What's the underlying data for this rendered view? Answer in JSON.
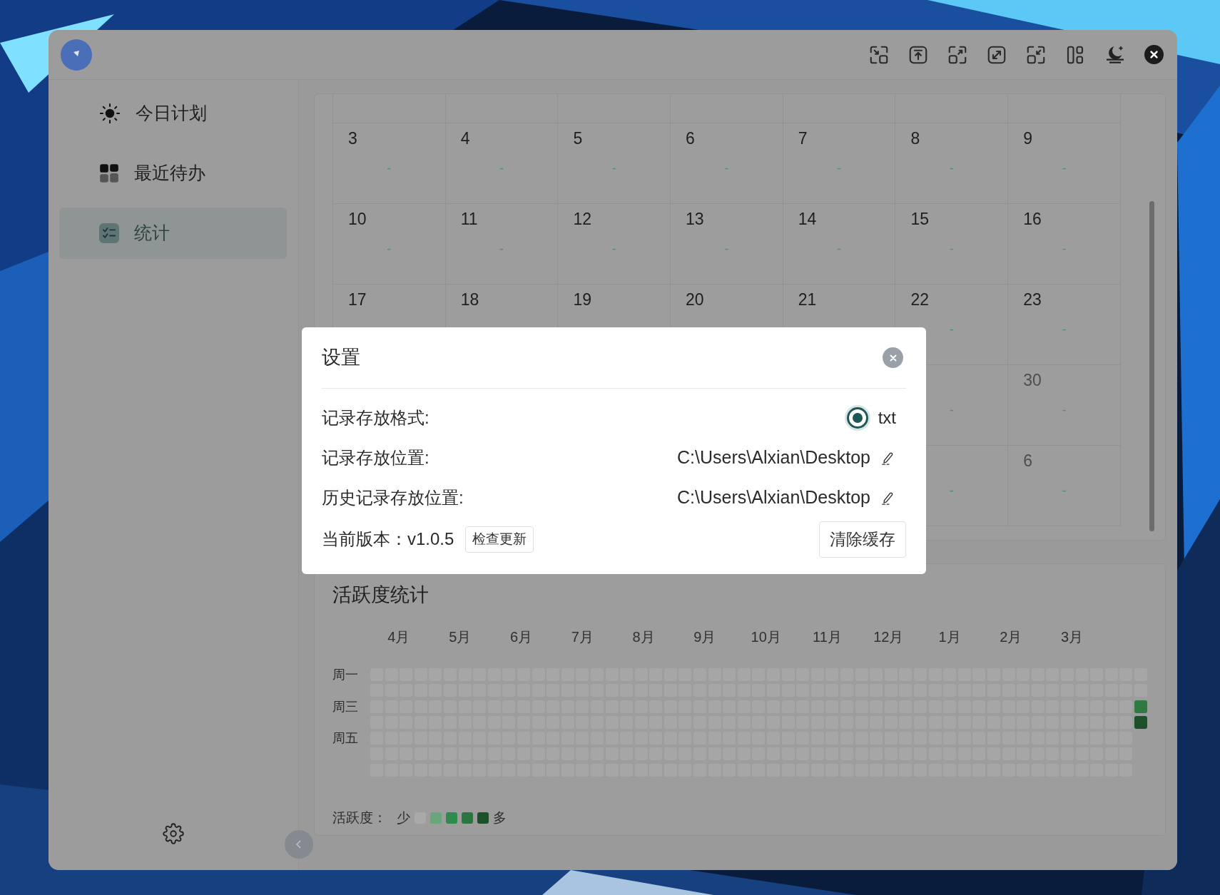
{
  "sidebar": {
    "items": [
      {
        "label": "今日计划",
        "kind": "sun",
        "selected": false
      },
      {
        "label": "最近待办",
        "kind": "grid",
        "selected": false
      },
      {
        "label": "统计",
        "kind": "checklist",
        "selected": true
      }
    ]
  },
  "calendar": {
    "weeks": [
      [
        {
          "day": "3",
          "mark": "-",
          "muted": false
        },
        {
          "day": "4",
          "mark": "-",
          "muted": false
        },
        {
          "day": "5",
          "mark": "-",
          "muted": false
        },
        {
          "day": "6",
          "mark": "-",
          "muted": false
        },
        {
          "day": "7",
          "mark": "-",
          "muted": false
        },
        {
          "day": "8",
          "mark": "-",
          "muted": false
        },
        {
          "day": "9",
          "mark": "-",
          "muted": false
        }
      ],
      [
        {
          "day": "10",
          "mark": "-",
          "muted": false
        },
        {
          "day": "11",
          "mark": "-",
          "muted": false
        },
        {
          "day": "12",
          "mark": "-",
          "muted": false
        },
        {
          "day": "13",
          "mark": "-",
          "muted": false
        },
        {
          "day": "14",
          "mark": "-",
          "muted": false
        },
        {
          "day": "15",
          "mark": "-",
          "muted": false
        },
        {
          "day": "16",
          "mark": "-",
          "muted": false
        }
      ],
      [
        {
          "day": "17",
          "muted": false
        },
        {
          "day": "18",
          "muted": false
        },
        {
          "day": "19",
          "muted": false
        },
        {
          "day": "20",
          "muted": false
        },
        {
          "day": "21",
          "muted": false
        },
        {
          "day": "22",
          "mark": "-",
          "muted": false
        },
        {
          "day": "23",
          "mark": "-",
          "muted": false
        }
      ],
      [
        {
          "mark": "-"
        },
        {
          "day": "30",
          "mark": "-",
          "muted": true
        }
      ],
      [
        {
          "mark": "-"
        },
        {
          "day": "6",
          "mark": "-",
          "muted": true
        }
      ]
    ]
  },
  "activity": {
    "title": "活跃度统计",
    "months": [
      "4月",
      "5月",
      "6月",
      "7月",
      "8月",
      "9月",
      "10月",
      "11月",
      "12月",
      "1月",
      "2月",
      "3月"
    ],
    "weekday_labels": [
      "周一",
      "周三",
      "周五"
    ],
    "recent_days": [
      {
        "color": "#a6a6a6"
      },
      {
        "color": "#a6a6a6"
      },
      {
        "color": "#2e7a42"
      },
      {
        "color": "#1c4f2a"
      }
    ],
    "legend": {
      "label": "活跃度：",
      "less": "少",
      "more": "多",
      "swatches": [
        {
          "color": "#a9a9a9"
        },
        {
          "color": "#6aa67a"
        },
        {
          "color": "#2f8b4b"
        },
        {
          "color": "#2a7540"
        },
        {
          "color": "#1c5029"
        }
      ]
    }
  },
  "dialog": {
    "title": "设置",
    "rows": [
      {
        "kind": "radio",
        "label": "记录存放格式:",
        "option": "txt",
        "selected": true
      },
      {
        "kind": "path",
        "label": "记录存放位置:",
        "value": "C:\\Users\\Alxian\\Desktop"
      },
      {
        "kind": "path",
        "label": "历史记录存放位置:",
        "value": "C:\\Users\\Alxian\\Desktop"
      }
    ],
    "version": "当前版本：v1.0.5",
    "check_button": "检查更新",
    "clear_button": "清除缓存"
  }
}
